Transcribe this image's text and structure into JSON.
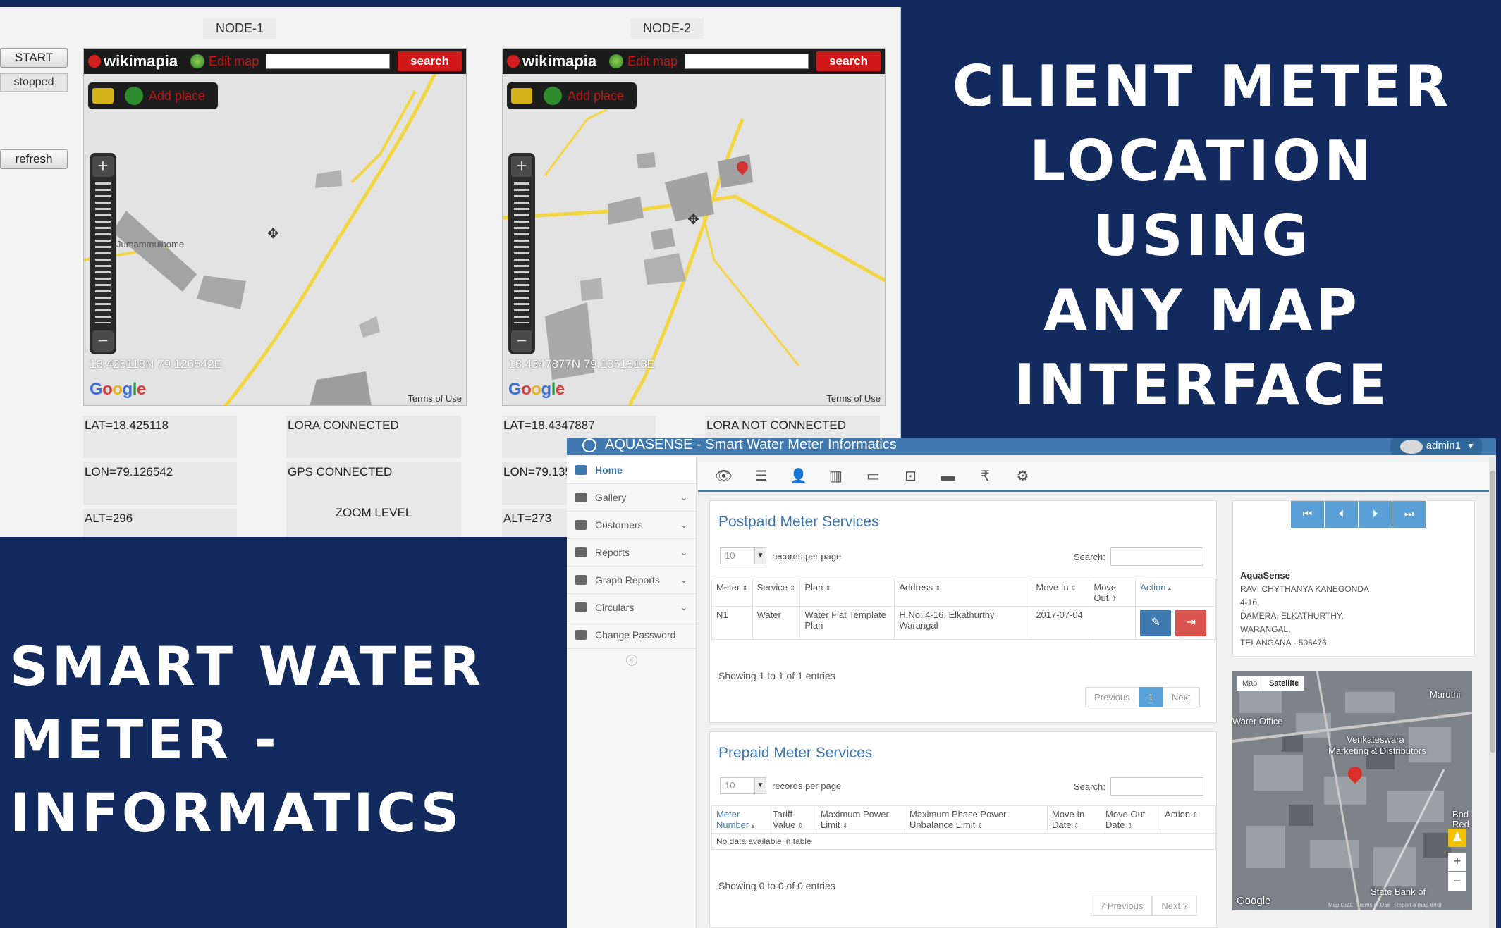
{
  "headings": {
    "right": [
      "CLIENT METER",
      "LOCATION USING",
      "ANY MAP",
      "INTERFACE"
    ],
    "left": [
      "SMART WATER",
      "METER -",
      "INFORMATICS"
    ]
  },
  "dashboard": {
    "start_button": "START",
    "status": "stopped",
    "refresh_button": "refresh",
    "nodes": [
      {
        "title": "NODE-1",
        "coords": "18.425118N 79.126542E",
        "poi": "Jumammulhome",
        "lat": "LAT=18.425118",
        "lon": "LON=79.126542",
        "alt": "ALT=296",
        "lora": "LORA CONNECTED",
        "gps": "GPS CONNECTED",
        "zoom_level": "ZOOM LEVEL"
      },
      {
        "title": "NODE-2",
        "coords": "18.4347877N 79.1351513E",
        "lat": "LAT=18.4347887",
        "lon": "LON=79.135",
        "alt": "ALT=273",
        "lora": "LORA NOT CONNECTED"
      }
    ],
    "map": {
      "logo": "wikimapia",
      "edit_map": "Edit map",
      "search": "search",
      "add_place": "Add place",
      "google": [
        "G",
        "o",
        "o",
        "g",
        "l",
        "e"
      ],
      "terms": "Terms of Use"
    }
  },
  "app": {
    "title": "AQUASENSE - Smart Water Meter Informatics",
    "user": "admin1",
    "nav": [
      {
        "label": "Home",
        "icon": "home-icon",
        "active": true
      },
      {
        "label": "Gallery",
        "icon": "image-icon"
      },
      {
        "label": "Customers",
        "icon": "users-icon"
      },
      {
        "label": "Reports",
        "icon": "edit-icon"
      },
      {
        "label": "Graph Reports",
        "icon": "pie-chart-icon"
      },
      {
        "label": "Circulars",
        "icon": "newspaper-icon"
      },
      {
        "label": "Change Password",
        "icon": "unlock-icon"
      }
    ],
    "toolbar_icons": [
      "eye-icon",
      "list-icon",
      "user-icon",
      "bar-chart-icon",
      "card-icon",
      "money-icon",
      "credit-card-icon",
      "rupee-icon",
      "gear-icon"
    ],
    "postpaid": {
      "title": "Postpaid Meter Services",
      "records_per_page_value": "10",
      "records_per_page_label": "records per page",
      "search_label": "Search:",
      "columns": [
        "Meter",
        "Service",
        "Plan",
        "Address",
        "Move In",
        "Move Out",
        "Action"
      ],
      "rows": [
        {
          "meter": "N1",
          "service": "Water",
          "plan": "Water Flat Template Plan",
          "address": "H.No.:4-16, Elkathurthy, Warangal",
          "move_in": "2017-07-04",
          "move_out": ""
        }
      ],
      "showing": "Showing 1 to 1 of 1 entries",
      "pager": [
        "Previous",
        "1",
        "Next"
      ]
    },
    "prepaid": {
      "title": "Prepaid Meter Services",
      "records_per_page_value": "10",
      "records_per_page_label": "records per page",
      "search_label": "Search:",
      "columns": [
        "Meter Number",
        "Tariff Value",
        "Maximum Power Limit",
        "Maximum Phase Power Unbalance Limit",
        "Move In Date",
        "Move Out Date",
        "Action"
      ],
      "empty": "No data available in table",
      "showing": "Showing 0 to 0 of 0 entries",
      "pager": [
        "? Previous",
        "Next ?"
      ]
    },
    "contact": {
      "name": "AquaSense",
      "lines": [
        "RAVI CHYTHANYA KANEGONDA",
        "4-16,",
        "DAMERA, ELKATHURTHY,",
        "WARANGAL,",
        "TELANGANA - 505476"
      ]
    },
    "sat_map": {
      "map_btn": "Map",
      "satellite_btn": "Satellite",
      "labels": [
        "Water Office",
        "Venkateswara",
        "Marketing & Distributors",
        "Maruthi",
        "State Bank of",
        "Bod",
        "Red"
      ],
      "google": "Google",
      "map_data": "Map Data",
      "terms": "Terms of Use",
      "report": "Report a map error"
    }
  }
}
